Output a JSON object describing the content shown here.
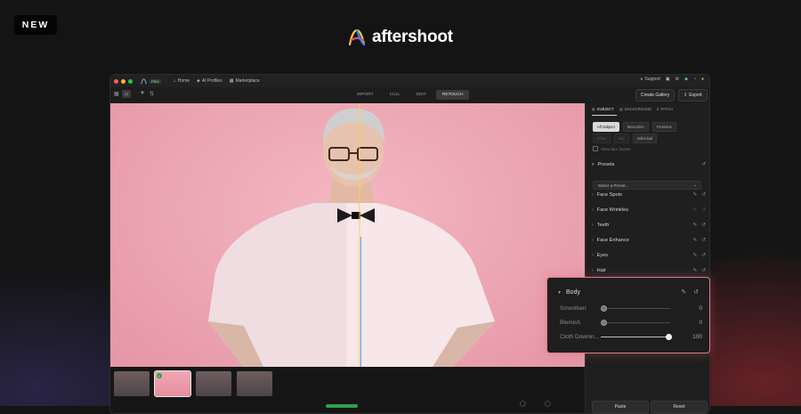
{
  "badge": "NEW",
  "brand": {
    "name": "aftershoot"
  },
  "titlebar": {
    "plan": "PRO",
    "nav": [
      {
        "label": "Home",
        "icon": "home-icon"
      },
      {
        "label": "AI Profiles",
        "icon": "profiles-icon"
      },
      {
        "label": "Marketplace",
        "icon": "marketplace-icon"
      }
    ],
    "support": "Support"
  },
  "toolbar": {
    "modes": [
      "IMPORT",
      "CULL",
      "EDIT",
      "RETOUCH"
    ],
    "active_mode": "RETOUCH",
    "create_gallery": "Create Gallery",
    "export": "Export"
  },
  "panel": {
    "tabs": [
      "SUBJECT",
      "BACKGROUND",
      "PATCH"
    ],
    "chips_row1": [
      "All Subject",
      "Masculine",
      "Feminine"
    ],
    "chips_row2": [
      "Infant",
      "Kid",
      "Individual"
    ],
    "show_face": "Show face frames",
    "presets_title": "Presets",
    "preset_placeholder": "Select a Preset...",
    "sections": [
      "Face Spots",
      "Face Wrinkles",
      "Teeth",
      "Face Enhance",
      "Eyes",
      "Hair"
    ],
    "paste": "Paste",
    "reset": "Reset"
  },
  "body_panel": {
    "title": "Body",
    "sliders": [
      {
        "label": "Smoothen",
        "value": "0",
        "fraction": 0
      },
      {
        "label": "Blemish",
        "value": "0",
        "fraction": 0
      },
      {
        "label": "Cloth Downin...",
        "value": "100",
        "fraction": 1
      }
    ]
  },
  "colors": {
    "accent_green": "#2e9e4a",
    "highlight": "#d97d8d"
  }
}
